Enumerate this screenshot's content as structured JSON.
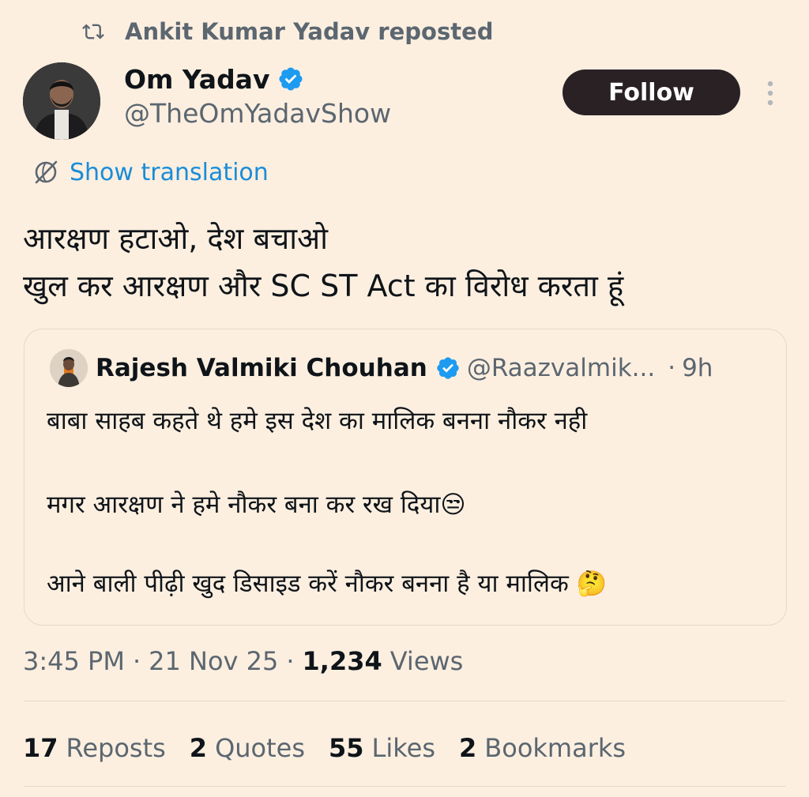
{
  "repost": {
    "text": "Ankit Kumar Yadav reposted",
    "icon": "repost-icon"
  },
  "author": {
    "name": "Om Yadav",
    "handle": "@TheOmYadavShow",
    "verified": true,
    "verified_color": "#1d9bf0"
  },
  "follow_button": {
    "label": "Follow"
  },
  "more_menu": {
    "icon": "more-vertical-icon"
  },
  "translation": {
    "label": "Show translation",
    "icon": "translate-icon"
  },
  "tweet": {
    "lines": [
      "आरक्षण हटाओ, देश बचाओ",
      "खुल कर आरक्षण और SC ST Act का विरोध करता हूं"
    ]
  },
  "quote": {
    "name": "Rajesh Valmiki Chouhan",
    "handle": "@Raazvalmik...",
    "time": "9h",
    "lines": [
      "बाबा साहब कहते थे हमे इस देश का मालिक बनना नौकर नही",
      "मगर आरक्षण ने हमे नौकर बना कर रख दिया😒",
      "आने बाली पीढ़ी खुद डिसाइड करें नौकर बनना है या मालिक 🤔"
    ]
  },
  "meta": {
    "time": "3:45 PM",
    "date": "21 Nov 25",
    "views_count": "1,234",
    "views_label": "Views"
  },
  "stats": [
    {
      "count": "17",
      "label": "Reposts"
    },
    {
      "count": "2",
      "label": "Quotes"
    },
    {
      "count": "55",
      "label": "Likes"
    },
    {
      "count": "2",
      "label": "Bookmarks"
    }
  ],
  "colors": {
    "background": "#fcefe0",
    "follow_bg": "#2a2125",
    "link": "#1a8cd8",
    "muted": "#5b6670"
  }
}
